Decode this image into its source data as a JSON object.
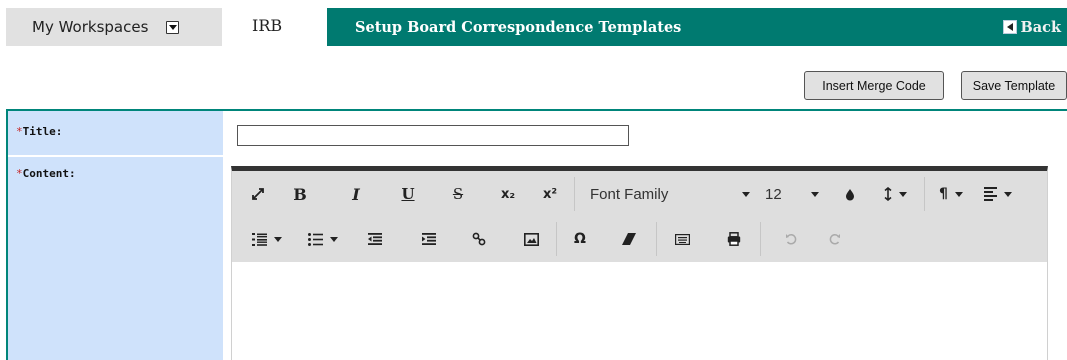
{
  "topbar": {
    "workspace_label": "My Workspaces",
    "module_label": "IRB",
    "page_title": "Setup Board Correspondence Templates",
    "back_label": "Back"
  },
  "actions": {
    "insert_merge_code": "Insert Merge Code",
    "save_template": "Save Template"
  },
  "form": {
    "required_marker": "*",
    "title_label": "Title:",
    "title_value": "",
    "content_label": "Content:"
  },
  "editor": {
    "toolbar_row1": [
      {
        "name": "fullscreen-icon",
        "glyph": "⤢"
      },
      {
        "name": "bold-icon",
        "glyph": "B"
      },
      {
        "name": "italic-icon",
        "glyph": "I"
      },
      {
        "name": "underline-icon",
        "glyph": "U"
      },
      {
        "name": "strikethrough-icon",
        "glyph": "S"
      },
      {
        "name": "subscript-icon",
        "glyph": "x₂"
      },
      {
        "name": "superscript-icon",
        "glyph": "x²"
      }
    ],
    "font_family": "Font Family",
    "font_size": "12",
    "toolbar_row2_icons": [
      "ordered-list-icon",
      "unordered-list-icon",
      "outdent-icon",
      "indent-icon",
      "link-icon",
      "image-icon",
      "special-character-icon",
      "clear-formatting-icon",
      "keyboard-icon",
      "print-icon",
      "undo-icon",
      "redo-icon"
    ],
    "special_char_glyph": "Ω",
    "content_value": ""
  },
  "colors": {
    "title_bar": "#007a70",
    "label_column": "#cfe2fb",
    "required": "#c62828"
  }
}
